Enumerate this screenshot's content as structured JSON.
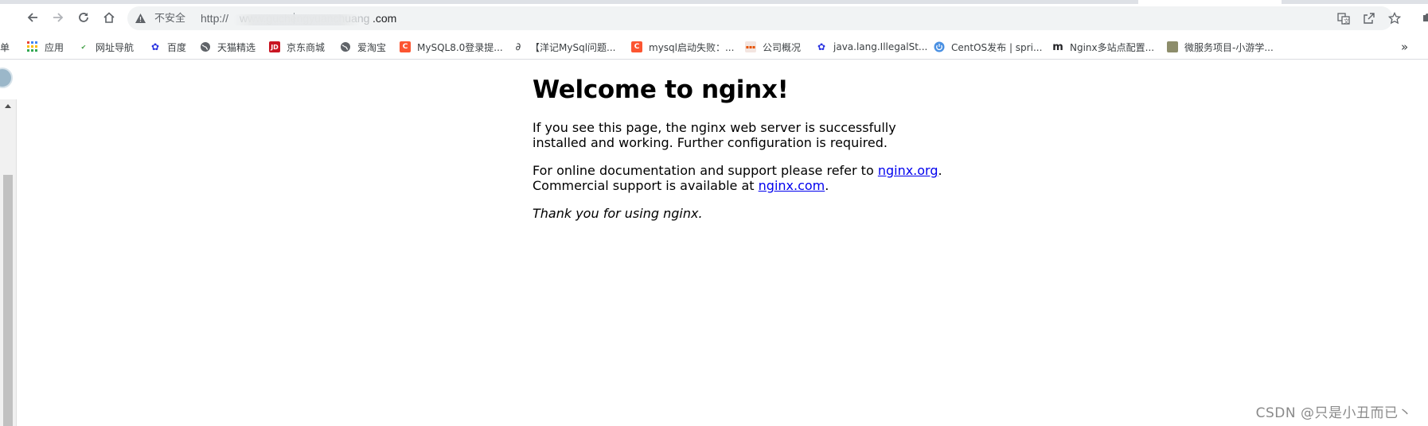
{
  "toolbar": {
    "back_icon": "arrow-left-icon",
    "forward_icon": "arrow-right-icon",
    "reload_icon": "reload-icon",
    "home_icon": "home-icon"
  },
  "omnibox": {
    "security_label": "不安全",
    "url_scheme": "http://",
    "url_domain_visible": "www.guchengyuanchuang",
    "url_tail": ".com"
  },
  "bookmarks": {
    "items": [
      {
        "label": "应用",
        "icon": "apps-grid-icon",
        "color": "#4285f4"
      },
      {
        "label": "网址导航",
        "icon": "hao-icon",
        "color": "#43a047"
      },
      {
        "label": "百度",
        "icon": "baidu-paw-icon",
        "color": "#2932e1"
      },
      {
        "label": "天猫精选",
        "icon": "globe-icon",
        "color": "#5f6368"
      },
      {
        "label": "京东商城",
        "icon": "jd-icon",
        "color": "#c91623"
      },
      {
        "label": "爱淘宝",
        "icon": "globe-icon",
        "color": "#5f6368"
      },
      {
        "label": "MySQL8.0登录提...",
        "icon": "csdn-c-icon",
        "color": "#fc5531"
      },
      {
        "label": "【洋记MySql问题...",
        "icon": "script-a-icon",
        "color": "#3c4043"
      },
      {
        "label": "mysql启动失败：...",
        "icon": "csdn-c-icon",
        "color": "#fc5531"
      },
      {
        "label": "公司概况",
        "icon": "site-icon",
        "color": "#e65100"
      },
      {
        "label": "java.lang.IllegalSt...",
        "icon": "baidu-paw-icon",
        "color": "#2932e1"
      },
      {
        "label": "CentOS发布 | spri...",
        "icon": "power-icon",
        "color": "#4a90e2"
      },
      {
        "label": "Nginx多站点配置...",
        "icon": "m-icon",
        "color": "#202124"
      },
      {
        "label": "微服务项目-小游学...",
        "icon": "image-thumb-icon",
        "color": "#8d8d6b"
      }
    ],
    "overflow_label": "»"
  },
  "page": {
    "heading": "Welcome to nginx!",
    "p1": "If you see this page, the nginx web server is successfully installed and working. Further configuration is required.",
    "p2_prefix": "For online documentation and support please refer to ",
    "p2_link1": "nginx.org",
    "p2_mid": ".",
    "p2_line2": "Commercial support is available at ",
    "p2_link2": "nginx.com",
    "p2_end": ".",
    "p3": "Thank you for using nginx."
  },
  "watermark": "CSDN @只是小丑而已丶"
}
